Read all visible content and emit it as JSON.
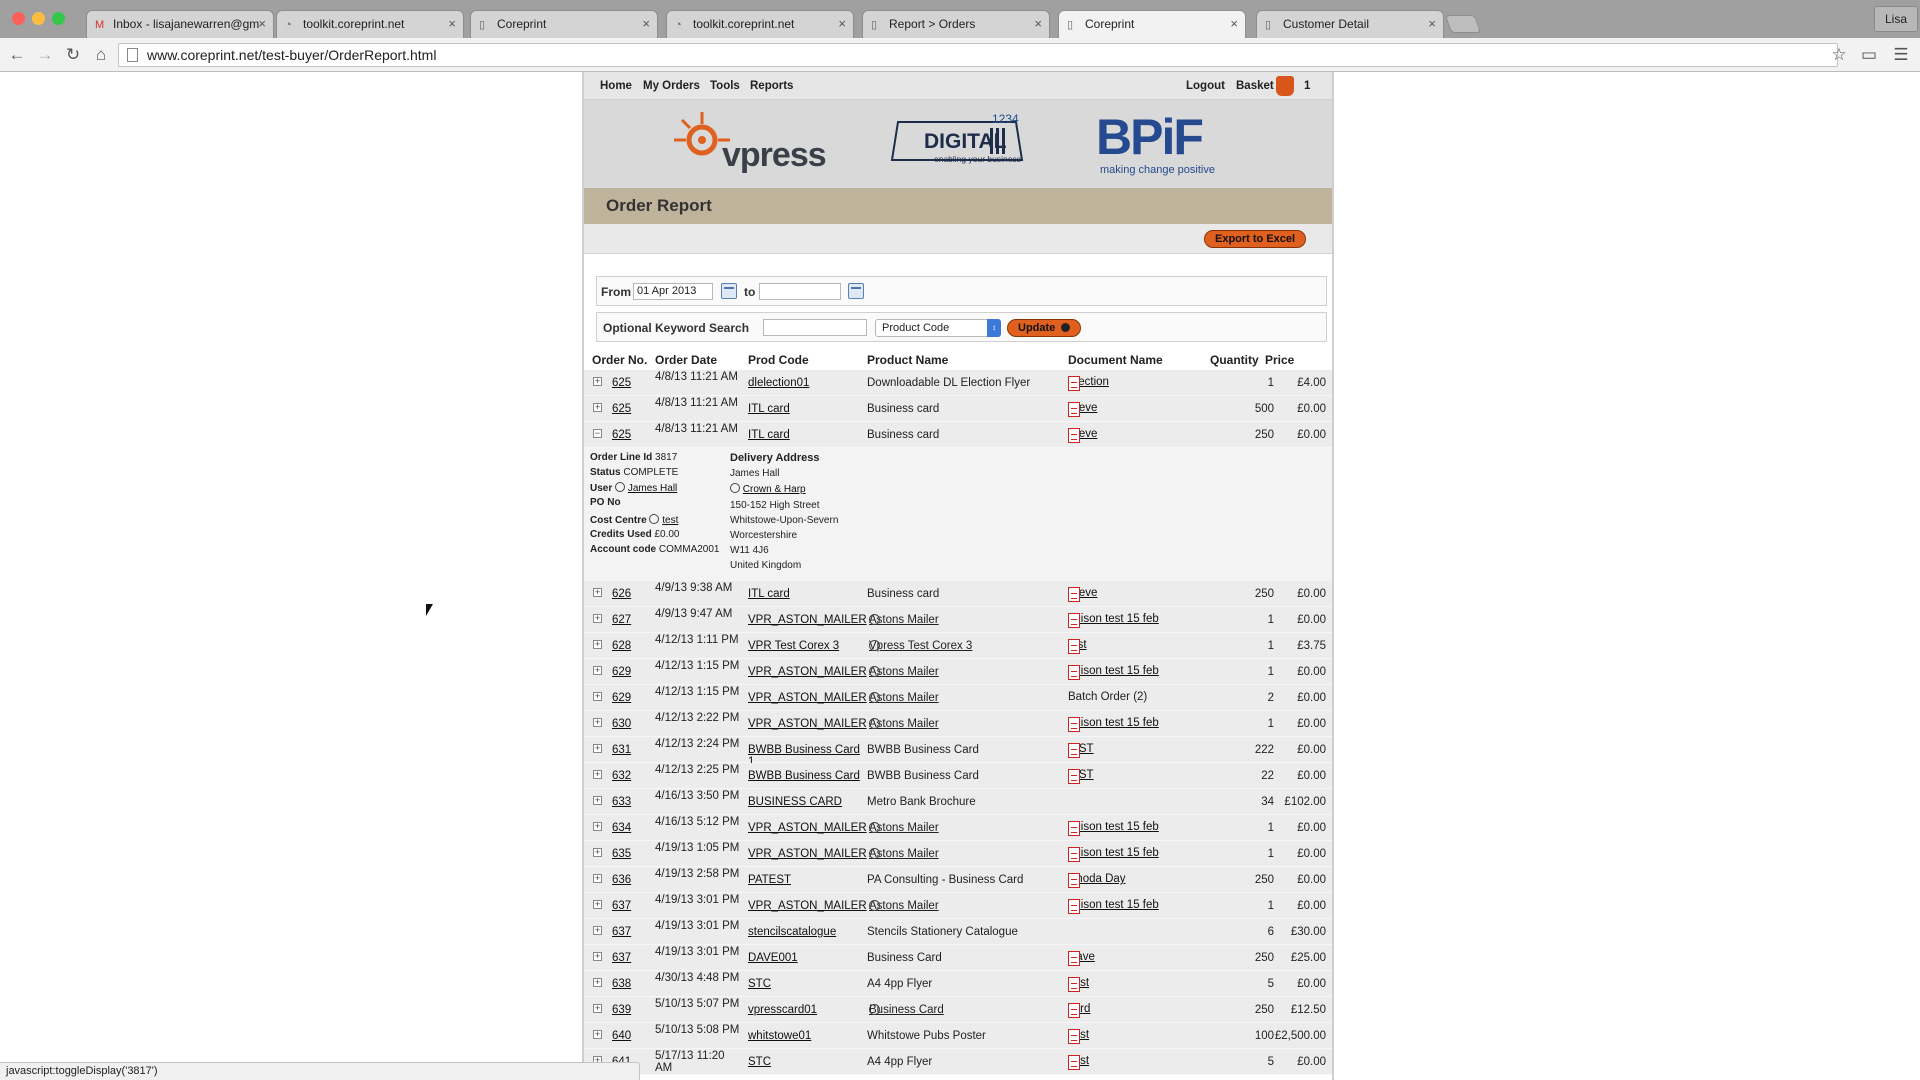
{
  "browser": {
    "profile": "Lisa",
    "url": "www.coreprint.net/test-buyer/OrderReport.html",
    "tabs": [
      {
        "title": "Inbox - lisajanewarren@gm",
        "icon": "gmail-icon"
      },
      {
        "title": "toolkit.coreprint.net",
        "icon": "loading-icon"
      },
      {
        "title": "Coreprint",
        "icon": "page-icon"
      },
      {
        "title": "toolkit.coreprint.net",
        "icon": "loading-icon"
      },
      {
        "title": "Report > Orders",
        "icon": "page-icon"
      },
      {
        "title": "Coreprint",
        "icon": "page-icon"
      },
      {
        "title": "Customer Detail",
        "icon": "page-icon"
      }
    ],
    "status_text": "javascript:toggleDisplay('3817')"
  },
  "site": {
    "nav": {
      "home": "Home",
      "my_orders": "My Orders",
      "tools": "Tools",
      "reports": "Reports",
      "logout": "Logout",
      "basket": "Basket",
      "basket_count": "1"
    },
    "logos": {
      "vpress": "vpress",
      "digital_num": "1234",
      "digital": "DIGITAL",
      "digital_tag": "enabling your business",
      "bpif": "BPiF",
      "bpif_tag": "making change positive"
    },
    "page_title": "Order Report",
    "export_label": "Export to Excel",
    "filters": {
      "from_label": "From",
      "from_value": "01 Apr 2013",
      "to_label": "to",
      "to_value": "",
      "keyword_label": "Optional Keyword Search",
      "keyword_value": "",
      "field_select": "Product Code",
      "update_label": "Update"
    },
    "columns": {
      "order_no": "Order No.",
      "order_date": "Order Date",
      "prod_code": "Prod Code",
      "product_name": "Product Name",
      "document_name": "Document Name",
      "quantity": "Quantity",
      "price": "Price"
    },
    "detail": {
      "order_line_label": "Order Line Id",
      "order_line_id": "3817",
      "status_label": "Status",
      "status": "COMPLETE",
      "user_label": "User",
      "user": "James Hall",
      "po_label": "PO No",
      "cost_centre_label": "Cost Centre",
      "cost_centre": "test",
      "credits_label": "Credits Used",
      "credits": "£0.00",
      "account_label": "Account code",
      "account_code": "COMMA2001",
      "delivery_label": "Delivery Address",
      "addr_name": "James Hall",
      "addr_company": "Crown & Harp",
      "addr_1": "150-152 High Street",
      "addr_2": "Whitstowe-Upon-Severn",
      "addr_3": "Worcestershire",
      "addr_4": "W11 4J6",
      "addr_5": "United Kingdom"
    },
    "rows": [
      {
        "order": "625",
        "date": "4/8/13 11:21 AM",
        "code": "dlelection01",
        "product": "Downloadable DL Election Flyer",
        "pglobe": false,
        "doc": "Election",
        "pdf": true,
        "qty": "1",
        "price": "£4.00",
        "expanded": false
      },
      {
        "order": "625",
        "date": "4/8/13 11:21 AM",
        "code": "ITL card",
        "product": "Business card",
        "pglobe": false,
        "doc": "Steve",
        "pdf": true,
        "qty": "500",
        "price": "£0.00",
        "expanded": false
      },
      {
        "order": "625",
        "date": "4/8/13 11:21 AM",
        "code": "ITL card",
        "product": "Business card",
        "pglobe": false,
        "doc": "Steve",
        "pdf": true,
        "qty": "250",
        "price": "£0.00",
        "expanded": true
      },
      {
        "order": "626",
        "date": "4/9/13 9:38 AM",
        "code": "ITL card",
        "product": "Business card",
        "pglobe": false,
        "doc": "Steve",
        "pdf": true,
        "qty": "250",
        "price": "£0.00",
        "expanded": false
      },
      {
        "order": "627",
        "date": "4/9/13 9:47 AM",
        "code": "VPR_ASTON_MAILER",
        "product": "Astons Mailer",
        "pglobe": true,
        "doc": "Allison test 15 feb",
        "pdf": true,
        "qty": "1",
        "price": "£0.00",
        "expanded": false
      },
      {
        "order": "628",
        "date": "4/12/13 1:11 PM",
        "code": "VPR Test Corex 3",
        "product": "Vpress Test Corex 3",
        "pglobe": true,
        "doc": "test",
        "pdf": true,
        "qty": "1",
        "price": "£3.75",
        "expanded": false
      },
      {
        "order": "629",
        "date": "4/12/13 1:15 PM",
        "code": "VPR_ASTON_MAILER",
        "product": "Astons Mailer",
        "pglobe": true,
        "doc": "Allison test 15 feb",
        "pdf": true,
        "qty": "1",
        "price": "£0.00",
        "expanded": false
      },
      {
        "order": "629",
        "date": "4/12/13 1:15 PM",
        "code": "VPR_ASTON_MAILER",
        "product": "Astons Mailer",
        "pglobe": true,
        "doc": "Batch Order (2)",
        "pdf": false,
        "qty": "2",
        "price": "£0.00",
        "expanded": false
      },
      {
        "order": "630",
        "date": "4/12/13 2:22 PM",
        "code": "VPR_ASTON_MAILER",
        "product": "Astons Mailer",
        "pglobe": true,
        "doc": "Allison test 15 feb",
        "pdf": true,
        "qty": "1",
        "price": "£0.00",
        "expanded": false
      },
      {
        "order": "631",
        "date": "4/12/13 2:24 PM",
        "code": "BWBB Business Card 1",
        "product": "BWBB Business Card",
        "pglobe": false,
        "doc": "tEST",
        "pdf": true,
        "qty": "222",
        "price": "£0.00",
        "expanded": false
      },
      {
        "order": "632",
        "date": "4/12/13 2:25 PM",
        "code": "BWBB Business Card",
        "product": "BWBB Business Card",
        "pglobe": false,
        "doc": "tEST",
        "pdf": true,
        "qty": "22",
        "price": "£0.00",
        "expanded": false
      },
      {
        "order": "633",
        "date": "4/16/13 3:50 PM",
        "code": "BUSINESS CARD",
        "product": "Metro Bank Brochure",
        "pglobe": false,
        "doc": "",
        "pdf": false,
        "qty": "34",
        "price": "£102.00",
        "expanded": false
      },
      {
        "order": "634",
        "date": "4/16/13 5:12 PM",
        "code": "VPR_ASTON_MAILER",
        "product": "Astons Mailer",
        "pglobe": true,
        "doc": "Allison test 15 feb",
        "pdf": true,
        "qty": "1",
        "price": "£0.00",
        "expanded": false
      },
      {
        "order": "635",
        "date": "4/19/13 1:05 PM",
        "code": "VPR_ASTON_MAILER",
        "product": "Astons Mailer",
        "pglobe": true,
        "doc": "Allison test 15 feb",
        "pdf": true,
        "qty": "1",
        "price": "£0.00",
        "expanded": false
      },
      {
        "order": "636",
        "date": "4/19/13 2:58 PM",
        "code": "PATEST",
        "product": "PA Consulting - Business Card",
        "pglobe": false,
        "doc": "Rhoda Day",
        "pdf": true,
        "qty": "250",
        "price": "£0.00",
        "expanded": false
      },
      {
        "order": "637",
        "date": "4/19/13 3:01 PM",
        "code": "VPR_ASTON_MAILER",
        "product": "Astons Mailer",
        "pglobe": true,
        "doc": "Allison test 15 feb",
        "pdf": true,
        "qty": "1",
        "price": "£0.00",
        "expanded": false
      },
      {
        "order": "637",
        "date": "4/19/13 3:01 PM",
        "code": "stencilscatalogue",
        "product": "Stencils Stationery Catalogue",
        "pglobe": false,
        "doc": "",
        "pdf": false,
        "qty": "6",
        "price": "£30.00",
        "expanded": false
      },
      {
        "order": "637",
        "date": "4/19/13 3:01 PM",
        "code": "DAVE001",
        "product": "Business Card",
        "pglobe": false,
        "doc": "Dave",
        "pdf": true,
        "qty": "250",
        "price": "£25.00",
        "expanded": false
      },
      {
        "order": "638",
        "date": "4/30/13 4:48 PM",
        "code": "STC",
        "product": "A4 4pp Flyer",
        "pglobe": false,
        "doc": "Test",
        "pdf": true,
        "qty": "5",
        "price": "£0.00",
        "expanded": false
      },
      {
        "order": "639",
        "date": "5/10/13 5:07 PM",
        "code": "vpresscard01",
        "product": "Business Card",
        "pglobe": true,
        "doc": "card",
        "pdf": true,
        "qty": "250",
        "price": "£12.50",
        "expanded": false
      },
      {
        "order": "640",
        "date": "5/10/13 5:08 PM",
        "code": "whitstowe01",
        "product": "Whitstowe Pubs Poster",
        "pglobe": false,
        "doc": "Test",
        "pdf": true,
        "qty": "100",
        "price": "£2,500.00",
        "expanded": false
      },
      {
        "order": "641",
        "date": "5/17/13 11:20 AM",
        "code": "STC",
        "product": "A4 4pp Flyer",
        "pglobe": false,
        "doc": "Test",
        "pdf": true,
        "qty": "5",
        "price": "£0.00",
        "expanded": false
      }
    ]
  },
  "colors": {
    "accent_orange": "#e0601f",
    "title_band": "#bfb39c",
    "row_bg": "#ececec"
  }
}
